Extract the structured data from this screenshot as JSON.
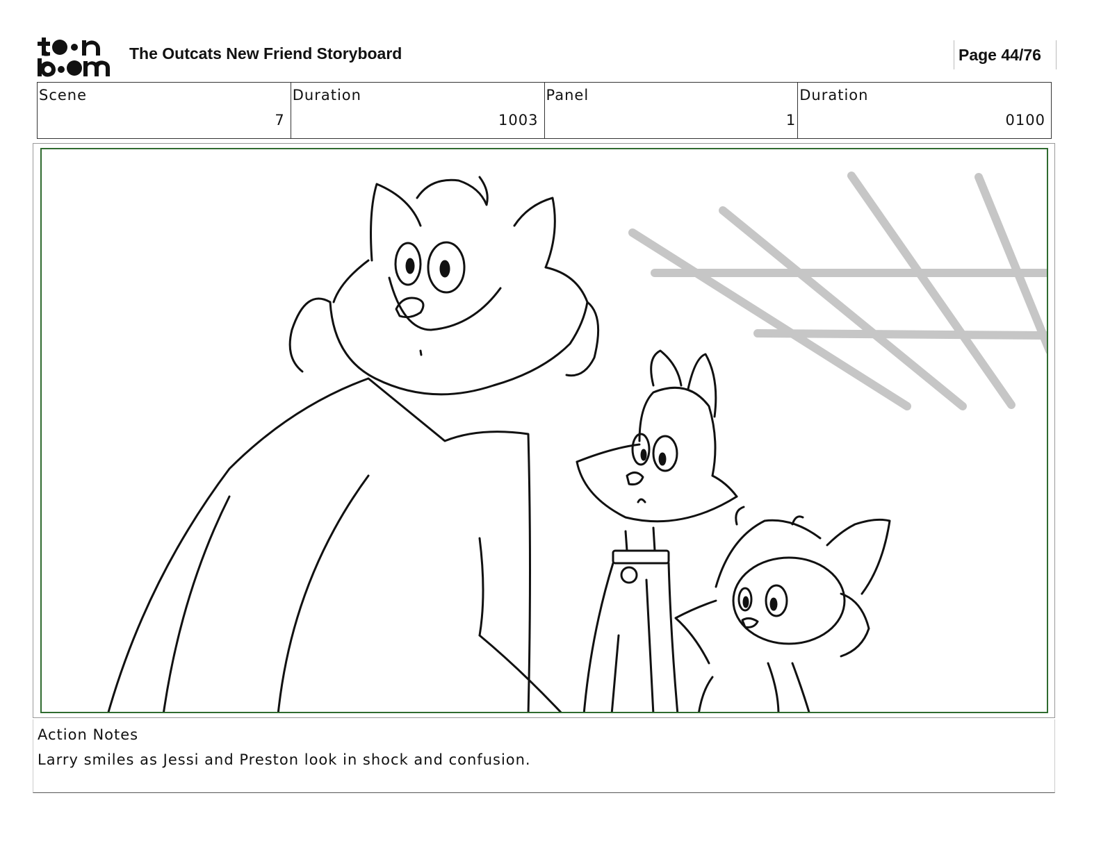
{
  "header": {
    "title": "The Outcats New Friend Storyboard",
    "page": "Page 44/76",
    "logo_text": "toonboom"
  },
  "info": {
    "scene_label": "Scene",
    "scene_value": "7",
    "duration_label": "Duration",
    "duration_value": "1003",
    "panel_label": "Panel",
    "panel_value": "1",
    "panel_duration_label": "Duration",
    "panel_duration_value": "0100"
  },
  "panel": {
    "frame_color": "#2f6b2f",
    "description_icon": "storyboard-sketch"
  },
  "notes": {
    "label": "Action Notes",
    "text": "Larry smiles as Jessi and Preston look in shock and confusion."
  }
}
